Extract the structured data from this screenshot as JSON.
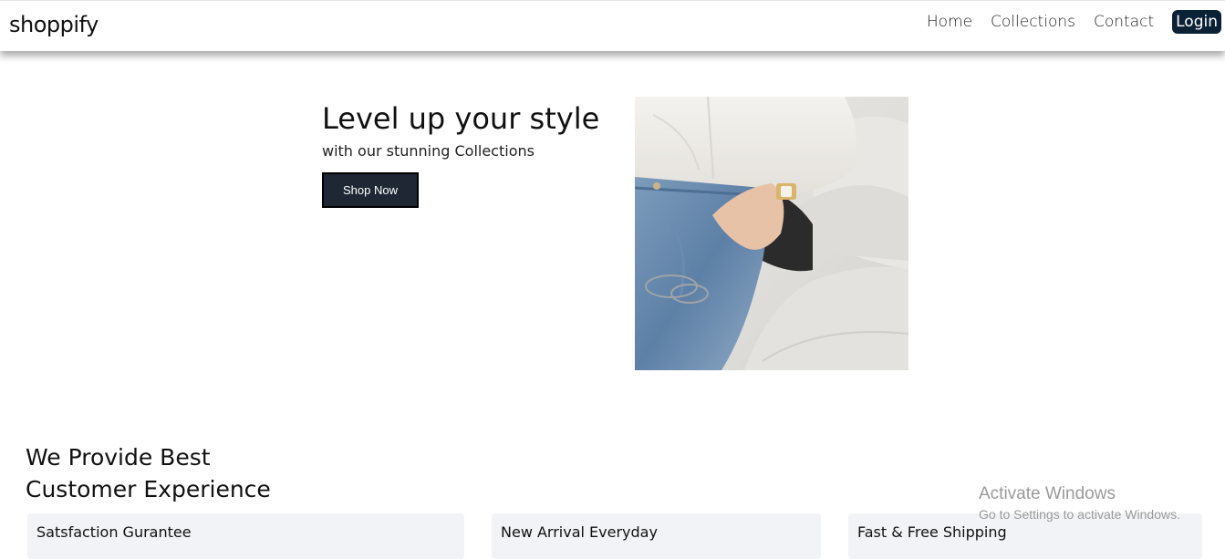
{
  "navbar": {
    "brand": "shoppify",
    "links": [
      "Home",
      "Collections",
      "Contact"
    ],
    "login_label": "Login"
  },
  "hero": {
    "title": "Level up your style",
    "subtitle": "with our stunning Collections",
    "cta_label": "Shop Now"
  },
  "features": {
    "title_line1": "We Provide Best",
    "title_line2": "Customer Experience",
    "cards": [
      "Satsfaction Gurantee",
      "New Arrival Everyday",
      "Fast & Free Shipping"
    ]
  },
  "watermark": {
    "title": "Activate Windows",
    "subtitle": "Go to Settings to activate Windows."
  },
  "colors": {
    "login_bg": "#0b2236",
    "cta_bg": "#1e2733",
    "card_bg": "#f2f3f6"
  }
}
